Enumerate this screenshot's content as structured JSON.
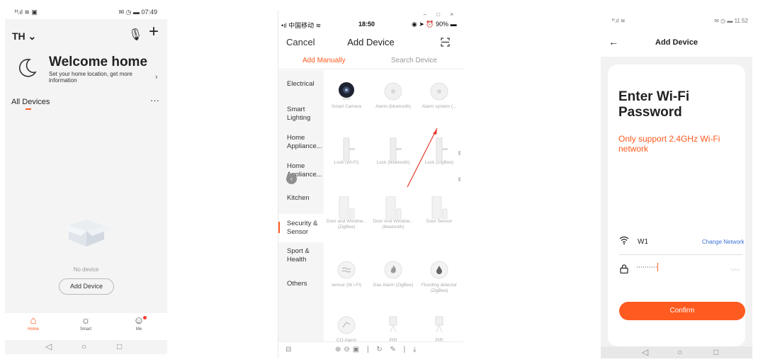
{
  "phone1": {
    "status_left": "ᴴ.ıl ≋ ▣",
    "status_right": "✉ ◷ ▬ 07:49",
    "home_name": "TH ⌄",
    "welcome_title": "Welcome home",
    "welcome_sub": "Set your home location, get more information",
    "all_devices": "All Devices",
    "more": "···",
    "no_device": "No device",
    "add_device": "Add Device",
    "tabs": [
      {
        "label": "Home",
        "icon": "house-icon",
        "glyph": "⌂"
      },
      {
        "label": "Smart",
        "icon": "sun-icon",
        "glyph": "☼"
      },
      {
        "label": "Me",
        "icon": "user-icon",
        "glyph": "☺"
      }
    ],
    "accent": "#ff5a1f"
  },
  "phone2": {
    "status_left": "•ıl 中国移动 ≋",
    "status_time": "18:50",
    "status_right": "◉ ➤ ⏰ 90% ▬",
    "window_buttons": "– □ ×",
    "cancel": "Cancel",
    "title": "Add Device",
    "tab_manual": "Add Manually",
    "tab_search": "Search Device",
    "categories": [
      "Electrical",
      "Smart Lighting",
      "Home Appliance...",
      "Home Appliance...",
      "Kitchen",
      "Security & Sensor",
      "Sport & Health",
      "Others"
    ],
    "devices": [
      "Smart Camera",
      "Alarm (bluetooth)",
      "Alarm system (...",
      "Lock (Wi-Fi)",
      "Lock (bluetooth)",
      "Lock (ZigBee)",
      "Door and Window... (ZigBee)",
      "Door And Window... (bluetooth)",
      "Door Sensor",
      "sensor (W i-Fi)",
      "Gas Alarm (ZigBee)",
      "Flooding detector (ZigBee)",
      "CO Alarm",
      "PIR",
      "PIR"
    ],
    "toolbar_left": "⊟",
    "toolbar_center": "⊕⊖▣ | ↻ ✎ | ⤓"
  },
  "phone3": {
    "status_left": "ᴴ.ıl ≋",
    "status_right": "✉ ◷ ▬ 11:52",
    "back": "←",
    "title": "Add Device",
    "heading": "Enter Wi-Fi Password",
    "note": "Only support 2.4GHz Wi-Fi network",
    "ssid": "W1",
    "change_network": "Change Network",
    "password_mask": "··········",
    "eye": "◡◡",
    "confirm": "Confirm"
  },
  "nav": [
    "◁",
    "○",
    "□"
  ]
}
